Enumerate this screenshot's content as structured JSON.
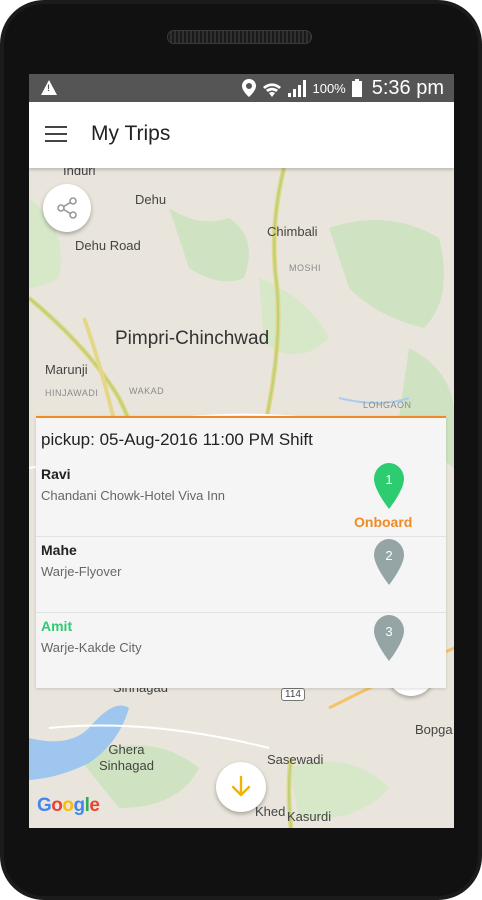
{
  "status_bar": {
    "battery": "100%",
    "time": "5:36 pm"
  },
  "toolbar": {
    "title": "My Trips"
  },
  "map": {
    "labels": [
      "Induri",
      "Dehu",
      "Dehu Road",
      "Chimbali",
      "MOSHI",
      "Pimpri-Chinchwad",
      "Marunji",
      "HINJAWADI",
      "WAKAD",
      "LOHGAON",
      "Sinhagad",
      "114",
      "Ghera\nSinhagad",
      "Sasewadi",
      "Bopga",
      "Khed",
      "Kasurdi"
    ],
    "attribution": "Google"
  },
  "trip": {
    "pickup": "pickup: 05-Aug-2016 11:00 PM Shift",
    "passengers": [
      {
        "number": "1",
        "name": "Ravi",
        "address": "Chandani Chowk-Hotel Viva Inn",
        "status": "Onboard",
        "pin_color": "#2ecc71"
      },
      {
        "number": "2",
        "name": "Mahe",
        "address": "Warje-Flyover",
        "status": "",
        "pin_color": "#95a5a6"
      },
      {
        "number": "3",
        "name": "Amit",
        "address": "Warje-Kakde City",
        "status": "",
        "pin_color": "#95a5a6"
      }
    ]
  },
  "colors": {
    "accent": "#f08a24",
    "onboard_green": "#2ecc71",
    "pending_grey": "#95a5a6",
    "status_bar": "#555555"
  }
}
